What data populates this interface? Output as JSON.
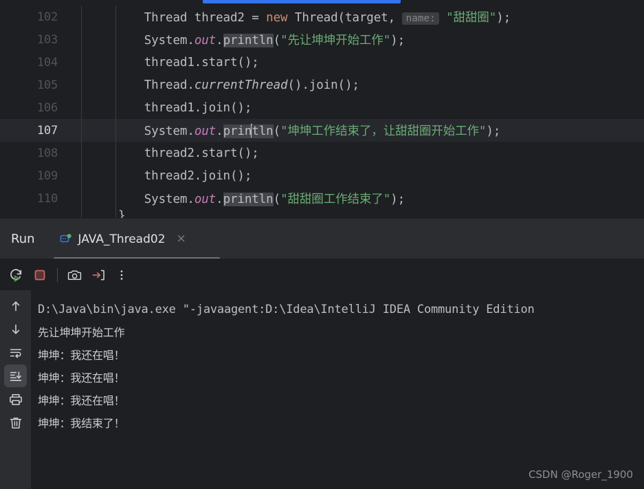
{
  "editor": {
    "indicator_color": "#3574f0",
    "current_line": 107,
    "trailing_brace": "}",
    "lines": [
      {
        "num": "102",
        "tokens": [
          {
            "t": "    ",
            "c": "plain"
          },
          {
            "t": "Thread thread2 = ",
            "c": "plain"
          },
          {
            "t": "new",
            "c": "kw"
          },
          {
            "t": " Thread(target, ",
            "c": "plain"
          },
          {
            "t": "name:",
            "c": "hint"
          },
          {
            "t": " ",
            "c": "plain"
          },
          {
            "t": "\"甜甜圈\"",
            "c": "str"
          },
          {
            "t": ");",
            "c": "plain"
          }
        ]
      },
      {
        "num": "103",
        "tokens": [
          {
            "t": "    ",
            "c": "plain"
          },
          {
            "t": "System.",
            "c": "plain"
          },
          {
            "t": "out",
            "c": "field"
          },
          {
            "t": ".",
            "c": "plain"
          },
          {
            "t": "println",
            "c": "hl"
          },
          {
            "t": "(",
            "c": "plain"
          },
          {
            "t": "\"先让坤坤开始工作\"",
            "c": "str"
          },
          {
            "t": ");",
            "c": "plain"
          }
        ]
      },
      {
        "num": "104",
        "tokens": [
          {
            "t": "    ",
            "c": "plain"
          },
          {
            "t": "thread1.start();",
            "c": "plain"
          }
        ]
      },
      {
        "num": "105",
        "tokens": [
          {
            "t": "    ",
            "c": "plain"
          },
          {
            "t": "Thread.",
            "c": "plain"
          },
          {
            "t": "currentThread",
            "c": "staticm"
          },
          {
            "t": "().join();",
            "c": "plain"
          }
        ]
      },
      {
        "num": "106",
        "tokens": [
          {
            "t": "    ",
            "c": "plain"
          },
          {
            "t": "thread1.join();",
            "c": "plain"
          }
        ]
      },
      {
        "num": "107",
        "current": true,
        "tokens": [
          {
            "t": "    ",
            "c": "plain"
          },
          {
            "t": "System.",
            "c": "plain"
          },
          {
            "t": "out",
            "c": "field"
          },
          {
            "t": ".",
            "c": "plain"
          },
          {
            "t": "prin",
            "c": "hl"
          },
          {
            "t": "",
            "c": "caret"
          },
          {
            "t": "tln",
            "c": "hl"
          },
          {
            "t": "(",
            "c": "plain"
          },
          {
            "t": "\"坤坤工作结束了，让甜甜圈开始工作\"",
            "c": "str"
          },
          {
            "t": ");",
            "c": "plain"
          }
        ]
      },
      {
        "num": "108",
        "tokens": [
          {
            "t": "    ",
            "c": "plain"
          },
          {
            "t": "thread2.start();",
            "c": "plain"
          }
        ]
      },
      {
        "num": "109",
        "tokens": [
          {
            "t": "    ",
            "c": "plain"
          },
          {
            "t": "thread2.join();",
            "c": "plain"
          }
        ]
      },
      {
        "num": "110",
        "tokens": [
          {
            "t": "    ",
            "c": "plain"
          },
          {
            "t": "System.",
            "c": "plain"
          },
          {
            "t": "out",
            "c": "field"
          },
          {
            "t": ".",
            "c": "plain"
          },
          {
            "t": "println",
            "c": "hl"
          },
          {
            "t": "(",
            "c": "plain"
          },
          {
            "t": "\"甜甜圈工作结束了\"",
            "c": "str"
          },
          {
            "t": ");",
            "c": "plain"
          }
        ]
      }
    ]
  },
  "run_panel": {
    "title": "Run",
    "tab": {
      "label": "JAVA_Thread02",
      "icon": "java-run-config-icon",
      "status_dot_color": "#5fad65",
      "close_label": "×"
    },
    "toolbar": [
      {
        "name": "rerun-button",
        "title": "Rerun"
      },
      {
        "name": "stop-button",
        "title": "Stop"
      },
      {
        "name": "screenshot-button",
        "title": "Screenshot"
      },
      {
        "name": "export-button",
        "title": "Export"
      },
      {
        "name": "more-options-button",
        "title": "More"
      }
    ],
    "sidebar": [
      {
        "name": "previous-occurrence-button",
        "title": "Up",
        "active": false
      },
      {
        "name": "next-occurrence-button",
        "title": "Down",
        "active": false
      },
      {
        "name": "soft-wrap-button",
        "title": "Soft-Wrap",
        "active": false
      },
      {
        "name": "scroll-to-end-button",
        "title": "Scroll to End",
        "active": true
      },
      {
        "name": "print-button",
        "title": "Print",
        "active": false
      },
      {
        "name": "clear-all-button",
        "title": "Clear All",
        "active": false
      }
    ],
    "console": {
      "lines": [
        {
          "text": "D:\\Java\\bin\\java.exe \"-javaagent:D:\\Idea\\IntelliJ IDEA Community Edition",
          "kind": "cmd"
        },
        {
          "text": "先让坤坤开始工作",
          "kind": "cn"
        },
        {
          "text": "坤坤：我还在唱！",
          "kind": "cn"
        },
        {
          "text": "坤坤：我还在唱！",
          "kind": "cn"
        },
        {
          "text": "坤坤：我还在唱！",
          "kind": "cn"
        },
        {
          "text": "坤坤：我结束了！",
          "kind": "cn"
        }
      ]
    }
  },
  "watermark": "CSDN @Roger_1900"
}
